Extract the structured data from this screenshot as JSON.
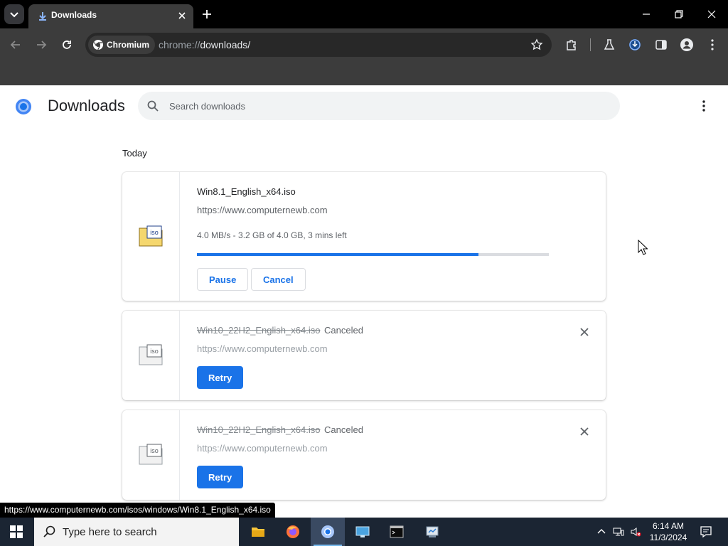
{
  "browser": {
    "tab": {
      "title": "Downloads"
    },
    "brand_chip": "Chromium",
    "url": {
      "scheme": "chrome://",
      "path": "downloads/"
    }
  },
  "page": {
    "title": "Downloads",
    "search_placeholder": "Search downloads",
    "section": "Today"
  },
  "downloads": [
    {
      "name": "Win8.1_English_x64.iso",
      "source": "https://www.computernewb.com",
      "description": "4.0 MB/s - 3.2 GB of 4.0 GB, 3 mins left",
      "progress": 0.8,
      "actions": [
        "Pause",
        "Cancel"
      ]
    },
    {
      "name": "Win10_22H2_English_x64.iso",
      "status": "Canceled",
      "source": "https://www.computernewb.com",
      "action": "Retry"
    },
    {
      "name": "Win10_22H2_English_x64.iso",
      "status": "Canceled",
      "source": "https://www.computernewb.com",
      "action": "Retry"
    }
  ],
  "status_bubble": "https://www.computernewb.com/isos/windows/Win8.1_English_x64.iso",
  "taskbar": {
    "search_placeholder": "Type here to search",
    "time": "6:14 AM",
    "date": "11/3/2024",
    "apps": [
      "file-explorer-icon",
      "firefox-icon",
      "chromium-icon",
      "remote-desktop-icon",
      "command-prompt-icon",
      "control-panel-icon"
    ]
  },
  "colors": {
    "accent": "#1a73e8",
    "toolbar": "#3c3c3c",
    "taskbar": "#1b2533"
  }
}
